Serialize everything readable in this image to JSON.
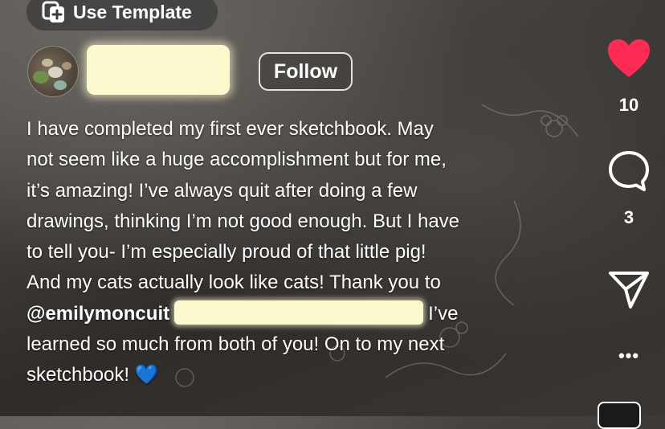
{
  "top_bar": {
    "use_template_label": "Use Template"
  },
  "post": {
    "follow_label": "Follow",
    "caption": {
      "line1": "I have completed my first ever sketchbook.  May",
      "line2": "not seem like a huge accomplishment but for me,",
      "line3": "it’s amazing!  I’ve always quit after doing a few",
      "line4": "drawings, thinking I’m not good enough.  But I have",
      "line5": "to tell you- I’m especially proud of that little pig!",
      "line6": "And my cats actually look like cats!  Thank you to",
      "mention": "@emilymoncuit",
      "line7_tail": "I’ve",
      "line8": "learned so much from both of you!  On to my next",
      "line9": "sketchbook! 💙"
    }
  },
  "actions": {
    "like_count": "10",
    "comment_count": "3",
    "more_glyph": "•••"
  },
  "colors": {
    "heart": "#fe2c55",
    "redaction": "#fdf9cf",
    "text": "#ffffff"
  },
  "icons": [
    "use-template-icon",
    "heart-icon",
    "comment-icon",
    "share-icon",
    "more-icon"
  ]
}
